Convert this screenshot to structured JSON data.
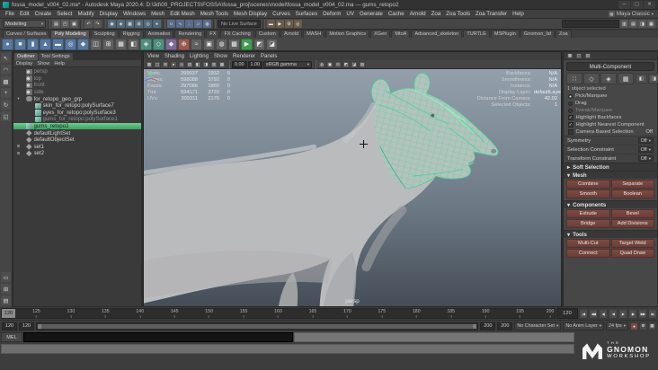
{
  "glyphs": {
    "caret": "▾",
    "expanded": "▾",
    "collapsed": "▸",
    "check": "✓"
  },
  "window": {
    "title": "fossa_model_v004_02.ma* - Autodesk Maya 2020.4: D:\\3d\\00_PROJECTS\\FOSSA\\fossa_proj\\scenes\\model\\fossa_model_v004_02.ma --- gums_retopo2",
    "minimize": "─",
    "maximize": "▢",
    "close": "✕"
  },
  "menu_bar": {
    "items": [
      "File",
      "Edit",
      "Create",
      "Select",
      "Modify",
      "Display",
      "Windows",
      "Mesh",
      "Edit Mesh",
      "Mesh Tools",
      "Mesh Display",
      "Curves",
      "Surfaces",
      "Deform",
      "UV",
      "Generate",
      "Cache",
      "Arnold",
      "Zoa",
      "Zoa Tools",
      "Zoa Transfer",
      "Help"
    ],
    "workspace_value": "Maya Classic"
  },
  "status_line": {
    "menuset": "Modeling",
    "live_surface": "No Live Surface",
    "icons_a": [
      {
        "g": "▤",
        "bg": "#5a5a5a"
      },
      {
        "g": "◰",
        "bg": "#5a5a5a"
      },
      {
        "g": "▣",
        "bg": "#5a5a5a"
      }
    ],
    "icons_b": [
      {
        "g": "↶",
        "bg": "#565656"
      },
      {
        "g": "↷",
        "bg": "#565656"
      }
    ],
    "icons_c": [
      {
        "g": "◉",
        "bg": "#50687a"
      },
      {
        "g": "◈",
        "bg": "#50687a"
      },
      {
        "g": "▦",
        "bg": "#50687a"
      },
      {
        "g": "⊞",
        "bg": "#50687a"
      },
      {
        "g": "◎",
        "bg": "#50687a"
      },
      {
        "g": "●",
        "bg": "#50687a"
      }
    ],
    "icons_d": [
      {
        "g": "∪",
        "bg": "#5a6a8a"
      },
      {
        "g": "∿",
        "bg": "#5a6a8a"
      },
      {
        "g": "∴",
        "bg": "#5a6a8a"
      },
      {
        "g": "▱",
        "bg": "#5a6a8a"
      },
      {
        "g": "◍",
        "bg": "#5a6a8a"
      }
    ],
    "icons_e": [
      {
        "g": "▬",
        "bg": "#6a5a4a"
      },
      {
        "g": "▶",
        "bg": "#6a5a4a"
      },
      {
        "g": "⚙",
        "bg": "#6a5a4a"
      },
      {
        "g": "◎",
        "bg": "#6a5a4a"
      }
    ],
    "icons_right": [
      {
        "g": "▥",
        "bg": "#565656"
      },
      {
        "g": "▤",
        "bg": "#565656"
      },
      {
        "g": "◨",
        "bg": "#565656"
      },
      {
        "g": "▦",
        "bg": "#565656"
      }
    ]
  },
  "shelf": {
    "tabs": [
      {
        "label": "Curves / Surfaces",
        "cls": ""
      },
      {
        "label": "Poly Modeling",
        "cls": "active"
      },
      {
        "label": "Sculpting",
        "cls": ""
      },
      {
        "label": "Rigging",
        "cls": ""
      },
      {
        "label": "Animation",
        "cls": ""
      },
      {
        "label": "Rendering",
        "cls": ""
      },
      {
        "label": "FX",
        "cls": ""
      },
      {
        "label": "FX Caching",
        "cls": ""
      },
      {
        "label": "Custom",
        "cls": ""
      },
      {
        "label": "Arnold",
        "cls": ""
      },
      {
        "label": "MASH",
        "cls": ""
      },
      {
        "label": "Motion Graphics",
        "cls": ""
      },
      {
        "label": "XGen",
        "cls": ""
      },
      {
        "label": "MtoA",
        "cls": ""
      },
      {
        "label": "Advanced_skeleton",
        "cls": ""
      },
      {
        "label": "TURTLE",
        "cls": ""
      },
      {
        "label": "MSPlugin",
        "cls": ""
      },
      {
        "label": "Gnomon_lid",
        "cls": ""
      },
      {
        "label": "Zoa",
        "cls": ""
      }
    ],
    "icons": [
      {
        "g": "●",
        "bg": "#56789f"
      },
      {
        "g": "■",
        "bg": "#56789f"
      },
      {
        "g": "▮",
        "bg": "#56789f"
      },
      {
        "g": "▲",
        "bg": "#56789f"
      },
      {
        "g": "▬",
        "bg": "#56789f"
      },
      {
        "g": "◎",
        "bg": "#56789f"
      },
      {
        "g": "◆",
        "bg": "#56789f"
      },
      {
        "g": "◫",
        "bg": "#606060"
      },
      {
        "g": "⊞",
        "bg": "#606060"
      },
      {
        "g": "▦",
        "bg": "#606060"
      },
      {
        "g": "◧",
        "bg": "#606060"
      },
      {
        "g": "◈",
        "bg": "#4f8f80"
      },
      {
        "g": "◇",
        "bg": "#4f8f80"
      },
      {
        "g": "◆",
        "bg": "#7a6a9a"
      },
      {
        "g": "⊕",
        "bg": "#9a5a50"
      },
      {
        "g": "≈",
        "bg": "#606060"
      },
      {
        "g": "▣",
        "bg": "#606060"
      },
      {
        "g": "◍",
        "bg": "#606060"
      },
      {
        "g": "▩",
        "bg": "#606060"
      },
      {
        "g": "▶",
        "bg": "#3f9e4f"
      },
      {
        "g": "◩",
        "bg": "#606060"
      },
      {
        "g": "◪",
        "bg": "#606060"
      }
    ]
  },
  "toolbox": {
    "tools": [
      {
        "g": "↖"
      },
      {
        "g": "◠"
      },
      {
        "g": "▩"
      },
      {
        "g": "+"
      },
      {
        "g": "↻"
      },
      {
        "g": "◱"
      }
    ],
    "layouts": [
      {
        "g": "▭"
      },
      {
        "g": "⊞"
      },
      {
        "g": "▤"
      }
    ]
  },
  "outliner": {
    "tabs": [
      {
        "label": "Outliner",
        "cls": "active"
      },
      {
        "label": "Tool Settings",
        "cls": ""
      }
    ],
    "menus": [
      "Display",
      "Show",
      "Help"
    ],
    "items": [
      {
        "label": "persp",
        "icon": "i-cam",
        "cls": "dim",
        "exp": ""
      },
      {
        "label": "top",
        "icon": "i-cam",
        "cls": "dim",
        "exp": ""
      },
      {
        "label": "front",
        "icon": "i-cam",
        "cls": "dim",
        "exp": ""
      },
      {
        "label": "side",
        "icon": "i-cam",
        "cls": "dim",
        "exp": ""
      },
      {
        "label": "for_retopo_geo_grp",
        "icon": "i-grp",
        "cls": "",
        "exp": "▾"
      },
      {
        "label": "skin_for_retopo:polySurface7",
        "icon": "i-mesh",
        "cls": "child",
        "exp": ""
      },
      {
        "label": "eyes_for_retopo:polySurface3",
        "icon": "i-mesh",
        "cls": "child",
        "exp": ""
      },
      {
        "label": "gums_for_retopo:polySurface1",
        "icon": "i-mesh",
        "cls": "child dim",
        "exp": ""
      },
      {
        "label": "gums_retopo2",
        "icon": "i-mesh",
        "cls": "selected",
        "exp": ""
      },
      {
        "label": "defaultLightSet",
        "icon": "i-set",
        "cls": "",
        "exp": ""
      },
      {
        "label": "defaultObjectSet",
        "icon": "i-set",
        "cls": "",
        "exp": ""
      },
      {
        "label": "set1",
        "icon": "i-set",
        "cls": "",
        "exp": "⊞"
      },
      {
        "label": "set2",
        "icon": "i-set",
        "cls": "",
        "exp": "⊞"
      }
    ]
  },
  "viewport": {
    "menus": [
      "View",
      "Shading",
      "Lighting",
      "Show",
      "Renderer",
      "Panels"
    ],
    "icons_a": [
      {
        "g": "▦"
      },
      {
        "g": "◫"
      },
      {
        "g": "⊞"
      },
      {
        "g": "●"
      },
      {
        "g": "◎"
      },
      {
        "g": "▤"
      },
      {
        "g": "◧"
      },
      {
        "g": "◨"
      },
      {
        "g": "▥"
      },
      {
        "g": "▩"
      }
    ],
    "exposure": "0.00",
    "gamma": "1.00",
    "view_transform": "sRGB gamma",
    "icons_b": [
      {
        "g": "◍"
      },
      {
        "g": "▣"
      },
      {
        "g": "⊟"
      },
      {
        "g": "◩"
      },
      {
        "g": "◪"
      },
      {
        "g": "▨"
      }
    ],
    "camera_label": "persp",
    "hud_left": [
      {
        "label": "Verts:",
        "v1": "299937",
        "v2": "1932",
        "v3": "0"
      },
      {
        "label": "Edges:",
        "v1": "598088",
        "v2": "3792",
        "v3": "0"
      },
      {
        "label": "Faces:",
        "v1": "297086",
        "v2": "1860",
        "v3": "0"
      },
      {
        "label": "Tris:",
        "v1": "594171",
        "v2": "3720",
        "v3": "0"
      },
      {
        "label": "UVs:",
        "v1": "309311",
        "v2": "2176",
        "v3": "0"
      }
    ],
    "hud_right": [
      {
        "label": "Backfaces:",
        "value": "N/A"
      },
      {
        "label": "Smoothness:",
        "value": "N/A"
      },
      {
        "label": "Instance:",
        "value": "N/A"
      },
      {
        "label": "Display Layer:",
        "value": "defaultLayer"
      },
      {
        "label": "Distance From Camera:",
        "value": "42.02"
      },
      {
        "label": "Selected Objects:",
        "value": "1"
      }
    ]
  },
  "toolkit": {
    "header_tabs": [
      {
        "g": "▦"
      },
      {
        "g": "◫"
      },
      {
        "g": "▤"
      }
    ],
    "multi_component": "Multi-Component",
    "modes": [
      {
        "g": "∷"
      },
      {
        "g": "◇"
      },
      {
        "g": "◈"
      },
      {
        "g": "▦"
      }
    ],
    "modes_extra": [
      {
        "g": "◧"
      },
      {
        "g": "◨"
      }
    ],
    "selected_info": "1 object selected",
    "radios": [
      {
        "label": "Pick/Marquee",
        "cls": "on"
      },
      {
        "label": "Drag",
        "cls": ""
      },
      {
        "label": "Tweak/Marquee",
        "cls": "muted"
      }
    ],
    "checks": [
      {
        "label": "Highlight Backfaces",
        "cls": "on"
      },
      {
        "label": "Highlight Nearest Component",
        "cls": "on"
      }
    ],
    "camera_based": {
      "label": "Camera Based Selection",
      "value": "Off"
    },
    "dropdown_rows": [
      {
        "label": "Symmetry",
        "value": "Off"
      },
      {
        "label": "Selection Constraint",
        "value": "Off"
      },
      {
        "label": "Transform Constraint",
        "value": "Off"
      }
    ],
    "soft_selection": "Soft Selection",
    "mesh_title": "Mesh",
    "mesh_buttons": [
      "Combine",
      "Separate",
      "Smooth",
      "Boolean"
    ],
    "components_title": "Components",
    "components_buttons": [
      "Extrude",
      "Bevel",
      "Bridge",
      "Add Divisions"
    ],
    "tools_title": "Tools",
    "tools_buttons": [
      "Multi-Cut",
      "Target Weld",
      "Connect",
      "Quad Draw"
    ]
  },
  "timeline": {
    "playhead_label": "120",
    "current_frame": "120",
    "ticks": [
      {
        "label": "125",
        "pos": "6.25%"
      },
      {
        "label": "130",
        "pos": "12.5%"
      },
      {
        "label": "135",
        "pos": "18.75%"
      },
      {
        "label": "140",
        "pos": "25%"
      },
      {
        "label": "145",
        "pos": "31.25%"
      },
      {
        "label": "150",
        "pos": "37.5%"
      },
      {
        "label": "155",
        "pos": "43.75%"
      },
      {
        "label": "160",
        "pos": "50%"
      },
      {
        "label": "165",
        "pos": "56.25%"
      },
      {
        "label": "170",
        "pos": "62.5%"
      },
      {
        "label": "175",
        "pos": "68.75%"
      },
      {
        "label": "180",
        "pos": "75%"
      },
      {
        "label": "185",
        "pos": "81.25%"
      },
      {
        "label": "190",
        "pos": "87.5%"
      },
      {
        "label": "195",
        "pos": "93.75%"
      },
      {
        "label": "200",
        "pos": "99.2%"
      }
    ],
    "playback": [
      {
        "g": "|◀"
      },
      {
        "g": "◀◀"
      },
      {
        "g": "◀|"
      },
      {
        "g": "◀"
      },
      {
        "g": "▶"
      },
      {
        "g": "|▶"
      },
      {
        "g": "▶▶"
      },
      {
        "g": "▶|"
      }
    ]
  },
  "range_slider": {
    "anim_start": "120",
    "play_start": "120",
    "play_end": "200",
    "anim_end": "200",
    "character_set": "No Character Set",
    "anim_layer": "No Anim Layer",
    "fps": "24 fps",
    "icons": [
      {
        "g": "●",
        "bg": "#7d4a44"
      },
      {
        "g": "⚙",
        "bg": "#4c4c4c"
      },
      {
        "g": "▦",
        "bg": "#4c4c4c"
      }
    ]
  },
  "command_line": {
    "label": "MEL"
  },
  "watermark": {
    "the": "THE",
    "gnomon": "GNOMON",
    "workshop": "WORKSHOP"
  }
}
